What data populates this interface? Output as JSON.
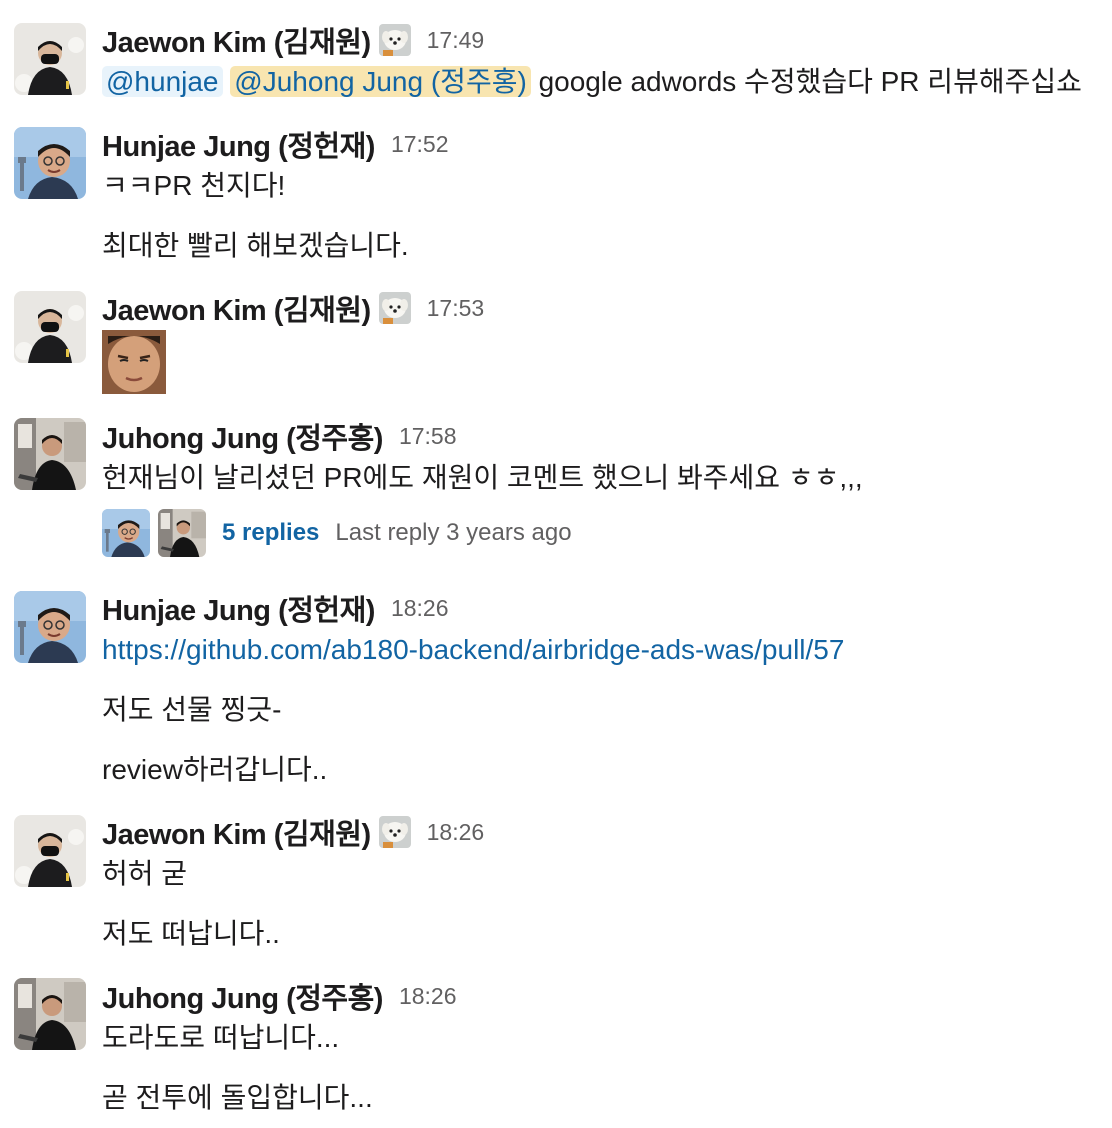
{
  "messages": [
    {
      "author": "Jaewon Kim (김재원)",
      "time": "17:49",
      "mentions": [
        "@hunjae",
        "@Juhong Jung (정주홍)"
      ],
      "text_after_mentions": "google adwords 수정했습다 PR 리뷰해주십쇼"
    },
    {
      "author": "Hunjae Jung (정헌재)",
      "time": "17:52",
      "lines": [
        "ㅋㅋPR 천지다!",
        "최대한 빨리 해보겠습니다."
      ]
    },
    {
      "author": "Jaewon Kim (김재원)",
      "time": "17:53",
      "image": "face-photo"
    },
    {
      "author": "Juhong Jung (정주홍)",
      "time": "17:58",
      "lines": [
        "헌재님이 날리셨던 PR에도 재원이 코멘트 했으니 봐주세요 ㅎㅎ,,,"
      ],
      "thread": {
        "replies": "5 replies",
        "last_reply": "Last reply 3 years ago"
      }
    },
    {
      "author": "Hunjae Jung (정헌재)",
      "time": "18:26",
      "link": "https://github.com/ab180-backend/airbridge-ads-was/pull/57",
      "lines": [
        "저도 선물 찡긋-",
        "review하러갑니다.."
      ]
    },
    {
      "author": "Jaewon Kim (김재원)",
      "time": "18:26",
      "lines": [
        "허허 굳",
        "저도 떠납니다.."
      ]
    },
    {
      "author": "Juhong Jung (정주홍)",
      "time": "18:26",
      "lines": [
        "도라도로 떠납니다...",
        "곧 전투에 돌입합니다..."
      ]
    }
  ],
  "colors": {
    "link": "#1264a3",
    "mention_bg_blue": "#e8f3fb",
    "mention_bg_gold": "#f8e5b0",
    "timestamp": "#616061",
    "text": "#1d1c1d"
  },
  "icons": {
    "status_emoji": "puppy-status-icon",
    "avatar_jaewon": "avatar-jaewon",
    "avatar_hunjae": "avatar-hunjae",
    "avatar_juhong": "avatar-juhong"
  }
}
